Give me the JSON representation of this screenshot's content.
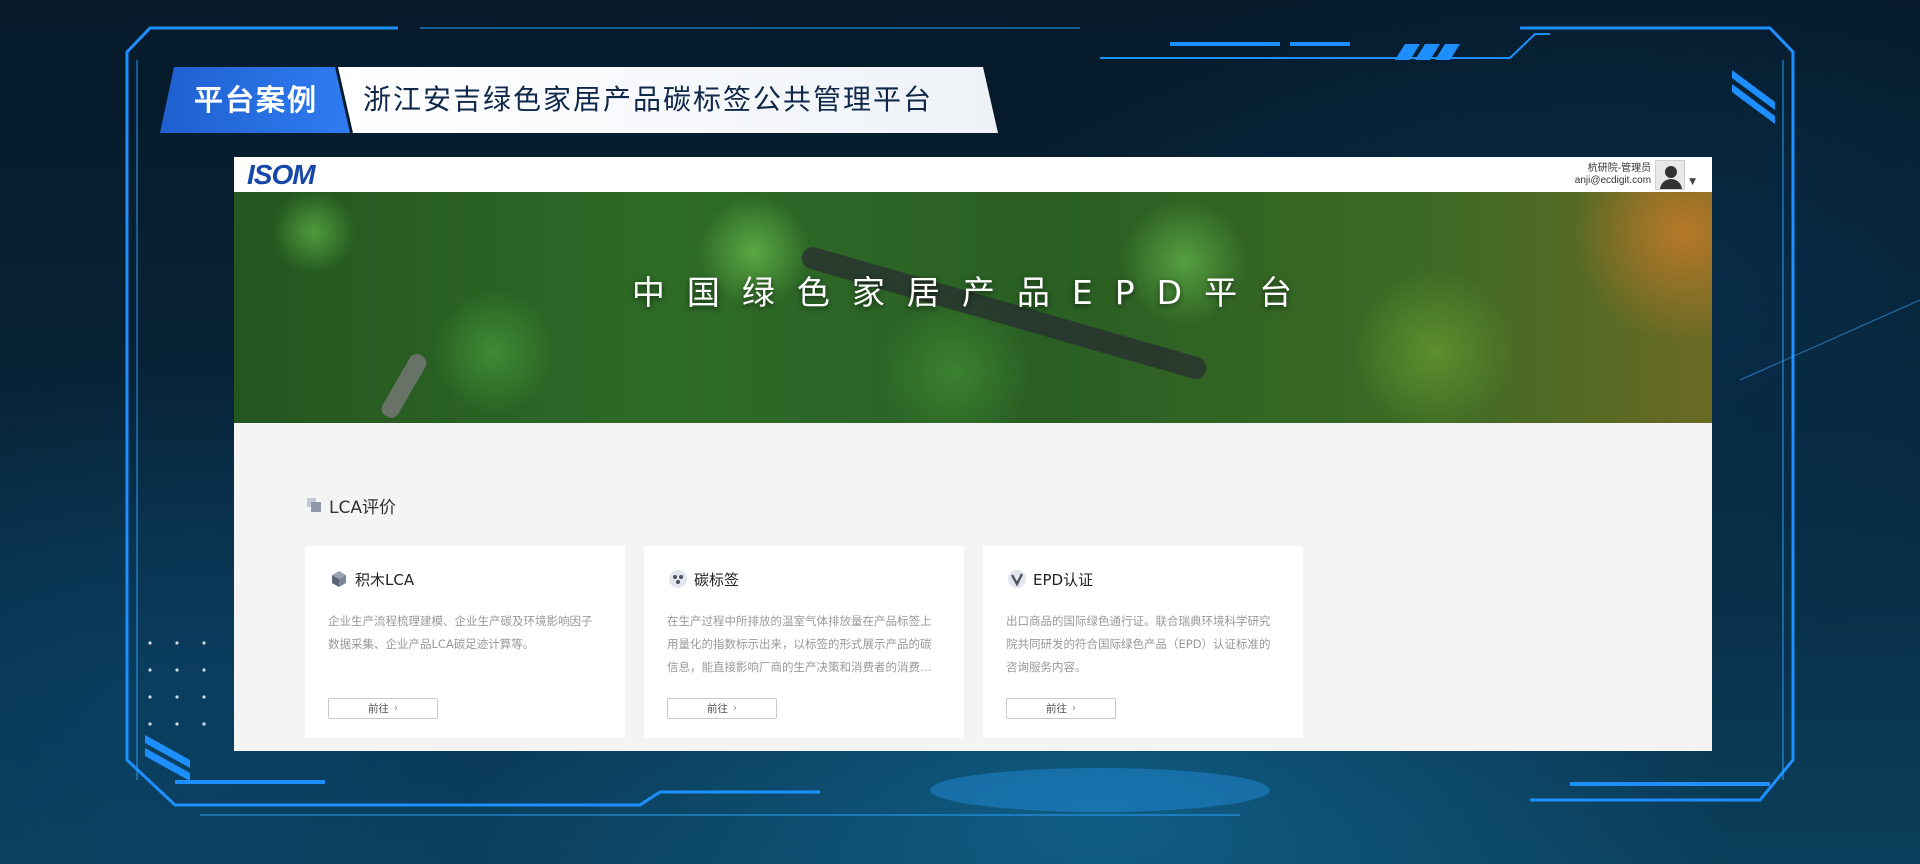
{
  "banner": {
    "tag": "平台案例",
    "title": "浙江安吉绿色家居产品碳标签公共管理平台"
  },
  "header": {
    "logo": "ISOM",
    "user_name": "杭研院-管理员",
    "user_email": "anji@ecdigit.com",
    "avatar_icon": "user-avatar-icon",
    "dropdown_icon": "caret-down-icon"
  },
  "hero": {
    "title": "中国绿色家居产品EPD平台"
  },
  "section": {
    "title": "LCA评价",
    "icon": "stack-squares-icon"
  },
  "cards": [
    {
      "icon": "blocks-icon",
      "title": "积木LCA",
      "description": "企业生产流程梳理建模、企业生产碳及环境影响因子数据采集、企业产品LCA碳足迹计算等。",
      "button": "前往"
    },
    {
      "icon": "carbon-label-icon",
      "title": "碳标签",
      "description": "在生产过程中所排放的温室气体排放量在产品标签上用量化的指数标示出来，以标签的形式展示产品的碳信息，能直接影响厂商的生产决策和消费者的消费…",
      "button": "前往"
    },
    {
      "icon": "epd-check-icon",
      "title": "EPD认证",
      "description": "出口商品的国际绿色通行证。联合瑞典环境科学研究院共同研发的符合国际绿色产品（EPD）认证标准的咨询服务内容。",
      "button": "前往"
    }
  ],
  "colors": {
    "frame_accent": "#1e8fff",
    "banner_tag_bg": "#2f7cf0",
    "logo_blue": "#1747a8",
    "content_bg": "#f4f4f4"
  }
}
